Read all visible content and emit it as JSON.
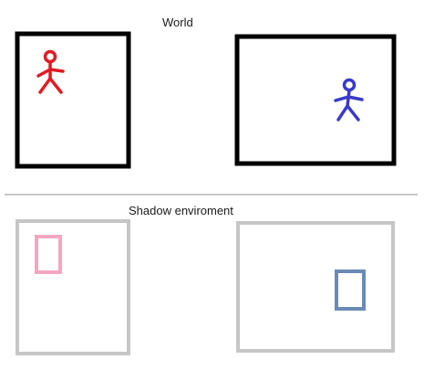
{
  "world": {
    "title": "World",
    "frame_color": "#000000",
    "figures": [
      {
        "name": "red-stick-figure",
        "color": "#e01b24"
      },
      {
        "name": "blue-stick-figure",
        "color": "#3a3acc"
      }
    ]
  },
  "shadow": {
    "title": "Shadow enviroment",
    "frame_color": "#c6c6c6",
    "shapes": [
      {
        "name": "pink-rectangle",
        "color": "#f4a6c0"
      },
      {
        "name": "steel-blue-rectangle",
        "color": "#6b8ab5"
      }
    ]
  },
  "divider_color": "#8c8c8c"
}
